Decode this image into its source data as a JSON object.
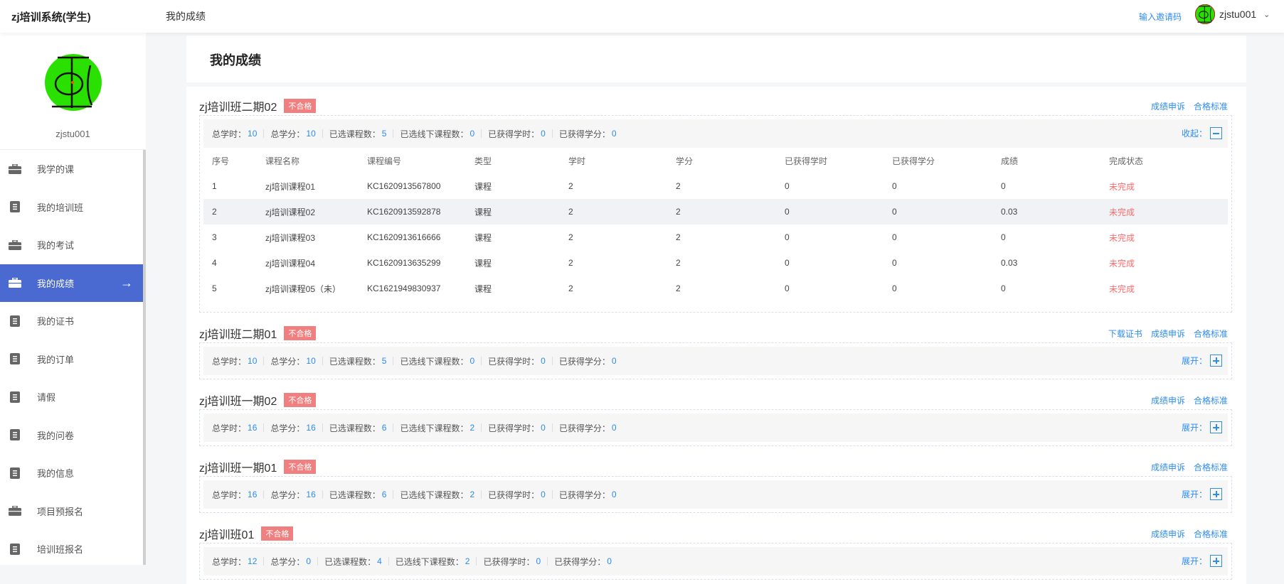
{
  "header": {
    "app_title": "zj培训系统(学生)",
    "crumb": "我的成绩",
    "invite": "输入邀请码",
    "username": "zjstu001"
  },
  "sidebar": {
    "username": "zjstu001",
    "items": [
      {
        "label": "我学的课",
        "icon": "briefcase-icon"
      },
      {
        "label": "我的培训班",
        "icon": "document-icon"
      },
      {
        "label": "我的考试",
        "icon": "briefcase-icon"
      },
      {
        "label": "我的成绩",
        "icon": "briefcase-icon",
        "active": true
      },
      {
        "label": "我的证书",
        "icon": "document-icon"
      },
      {
        "label": "我的订单",
        "icon": "document-icon"
      },
      {
        "label": "请假",
        "icon": "document-icon"
      },
      {
        "label": "我的问卷",
        "icon": "document-icon"
      },
      {
        "label": "我的信息",
        "icon": "document-icon"
      },
      {
        "label": "项目预报名",
        "icon": "briefcase-icon"
      },
      {
        "label": "培训班报名",
        "icon": "document-icon"
      }
    ]
  },
  "page_title": "我的成绩",
  "labels": {
    "badge": "不合格",
    "appeal": "成绩申诉",
    "standard": "合格标准",
    "download": "下载证书",
    "collapse": "收起：",
    "expand": "展开：",
    "total_hours": "总学时：",
    "total_credits": "总学分：",
    "courses": "已选课程数：",
    "offline": "已选线下课程数：",
    "got_hours": "已获得学时：",
    "got_credits": "已获得学分："
  },
  "columns": [
    "序号",
    "课程名称",
    "课程编号",
    "类型",
    "学时",
    "学分",
    "已获得学时",
    "已获得学分",
    "成绩",
    "完成状态"
  ],
  "sections": [
    {
      "title": "zj培训班二期02",
      "stats": [
        "10",
        "10",
        "5",
        "0",
        "0",
        "0"
      ],
      "rows": [
        [
          "1",
          "zj培训课程01",
          "KC1620913567800",
          "课程",
          "2",
          "2",
          "0",
          "0",
          "0",
          "未完成"
        ],
        [
          "2",
          "zj培训课程02",
          "KC1620913592878",
          "课程",
          "2",
          "2",
          "0",
          "0",
          "0.03",
          "未完成"
        ],
        [
          "3",
          "zj培训课程03",
          "KC1620913616666",
          "课程",
          "2",
          "2",
          "0",
          "0",
          "0",
          "未完成"
        ],
        [
          "4",
          "zj培训课程04",
          "KC1620913635299",
          "课程",
          "2",
          "2",
          "0",
          "0",
          "0.03",
          "未完成"
        ],
        [
          "5",
          "zj培训课程05（未）",
          "KC1621949830937",
          "课程",
          "2",
          "2",
          "0",
          "0",
          "0",
          "未完成"
        ]
      ]
    },
    {
      "title": "zj培训班二期01",
      "stats": [
        "10",
        "10",
        "5",
        "0",
        "0",
        "0"
      ]
    },
    {
      "title": "zj培训班一期02",
      "stats": [
        "16",
        "16",
        "6",
        "2",
        "0",
        "0"
      ]
    },
    {
      "title": "zj培训班一期01",
      "stats": [
        "16",
        "16",
        "6",
        "2",
        "0",
        "0"
      ]
    },
    {
      "title": "zj培训班01",
      "stats": [
        "12",
        "0",
        "4",
        "2",
        "0",
        "0"
      ]
    }
  ]
}
